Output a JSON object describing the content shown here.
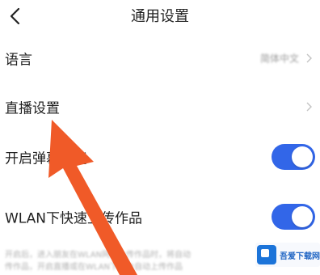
{
  "header": {
    "title": "通用设置"
  },
  "settings": {
    "language": {
      "label": "语言",
      "value": "简体中文"
    },
    "live": {
      "label": "直播设置"
    },
    "danmaku": {
      "label": "开启弹幕功能",
      "enabled": true
    },
    "wlan_upload": {
      "label": "WLAN下快速上传作品",
      "enabled": true
    }
  },
  "footnote": {
    "line1": "开启后，进入朋友在WLAN网络上传作品时，将自动",
    "line2": "传作品，开启直播或在WLAN下后台自动上传作品"
  },
  "watermark": {
    "text": "吾爱下载网"
  },
  "colors": {
    "toggle_on": "#3266e8",
    "arrow": "#f05a28"
  }
}
